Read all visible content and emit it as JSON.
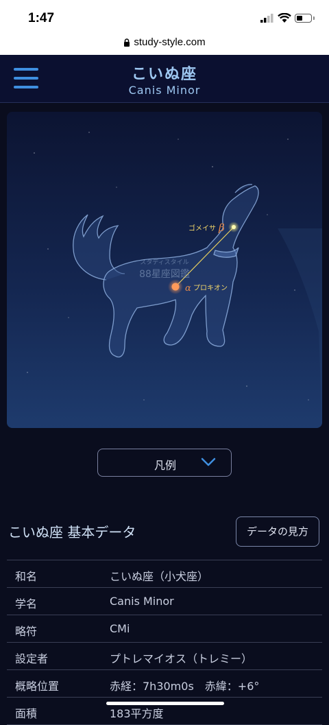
{
  "status_bar": {
    "time": "1:47"
  },
  "browser": {
    "url": "study-style.com"
  },
  "header": {
    "title_ja": "こいぬ座",
    "title_en": "Canis Minor"
  },
  "chart": {
    "stars": {
      "beta": {
        "name": "ゴメイサ",
        "greek": "β"
      },
      "alpha": {
        "name": "プロキオン",
        "greek": "α"
      }
    },
    "watermark": {
      "line1": "スタディスタイル",
      "line2": "88星座図鑑"
    }
  },
  "legend": {
    "label": "凡例"
  },
  "basic_data": {
    "title": "こいぬ座 基本データ",
    "howto_button": "データの見方",
    "rows": [
      {
        "key": "和名",
        "value": "こいぬ座（小犬座）"
      },
      {
        "key": "学名",
        "value": "Canis Minor"
      },
      {
        "key": "略符",
        "value": "CMi"
      },
      {
        "key": "設定者",
        "value": "プトレマイオス（トレミー）"
      },
      {
        "key": "概略位置",
        "value": "赤経：7h30m0s　赤緯：+6°"
      },
      {
        "key": "面積",
        "value": "183平方度"
      }
    ]
  },
  "colors": {
    "accent": "#3f8fe0",
    "title": "#9ec8f2",
    "alpha_star": "#ff8a4a",
    "beta_star": "#f2e86a",
    "star_label": "#f4d86a"
  }
}
